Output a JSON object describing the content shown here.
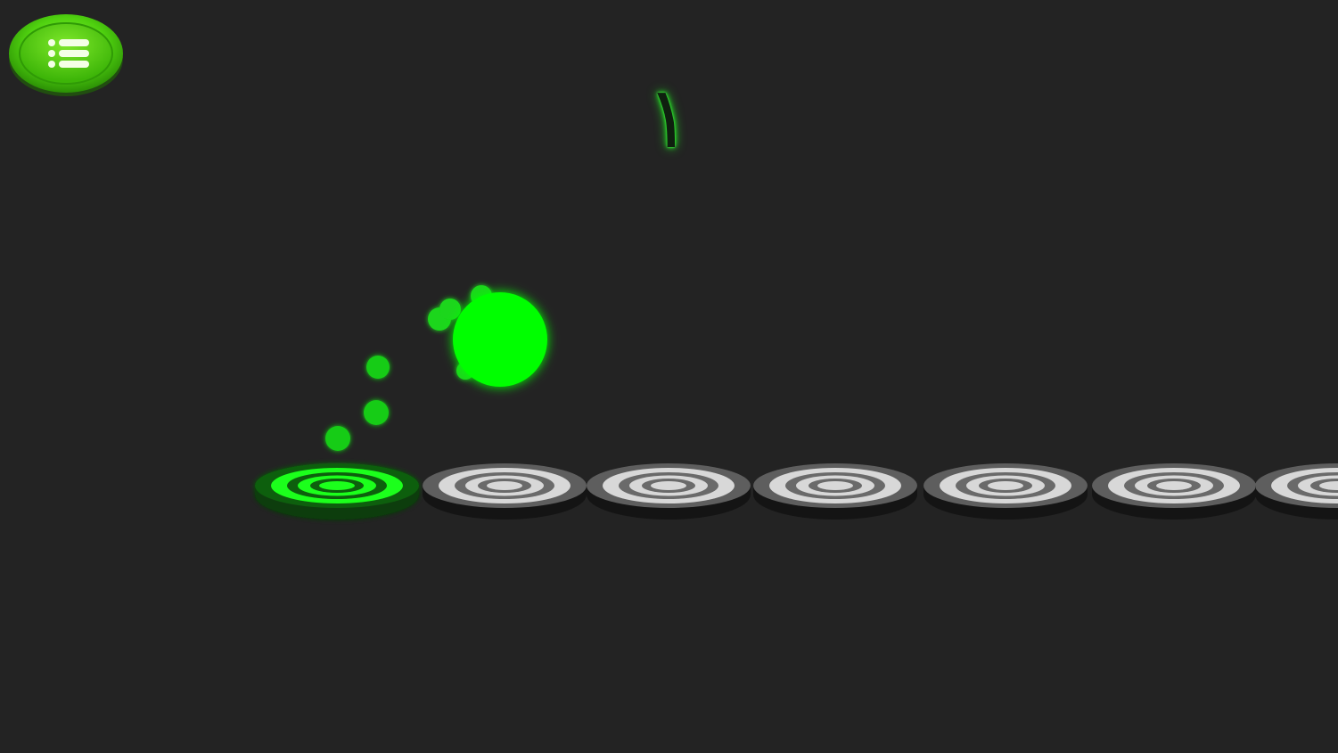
{
  "score": {
    "value": "١"
  },
  "menu_button": {
    "icon": "list-menu-icon",
    "color": "#4fd10f"
  },
  "colors": {
    "background": "#232323",
    "active_green": "#1aff1a",
    "ball": "#00ff00",
    "pad_light": "#d8d8d8",
    "pad_dark": "#6a6a6a",
    "pad_base": "#1a1a1a"
  },
  "pads": [
    {
      "state": "active"
    },
    {
      "state": "inactive"
    },
    {
      "state": "inactive"
    },
    {
      "state": "inactive"
    },
    {
      "state": "inactive"
    },
    {
      "state": "inactive"
    },
    {
      "state": "inactive"
    }
  ]
}
